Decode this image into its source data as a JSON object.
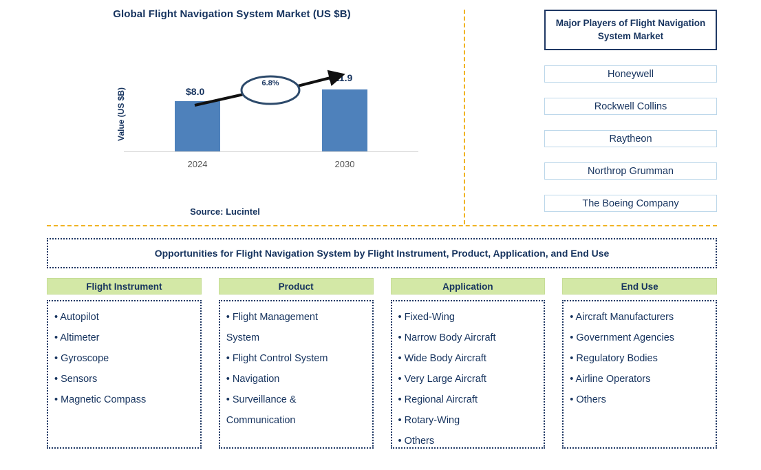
{
  "chart_panel": {
    "title": "Global Flight Navigation System Market (US $B)",
    "y_axis_label": "Value (US $B)",
    "source": "Source: Lucintel"
  },
  "chart_data": {
    "type": "bar",
    "title": "Global Flight Navigation System Market (US $B)",
    "xlabel": "",
    "ylabel": "Value (US $B)",
    "categories": [
      "2024",
      "2030"
    ],
    "values": [
      8.0,
      11.9
    ],
    "value_labels": [
      "$8.0",
      "$11.9"
    ],
    "ylim": [
      0,
      13
    ],
    "grid": false,
    "legend": "none",
    "bar_color": "#4e81bb",
    "annotation": {
      "label": "6.8%",
      "kind": "cagr-arrow",
      "from_category": "2024",
      "to_category": "2030"
    }
  },
  "players": {
    "header": "Major Players of Flight Navigation System Market",
    "items": [
      {
        "name": "Honeywell"
      },
      {
        "name": "Rockwell Collins"
      },
      {
        "name": "Raytheon"
      },
      {
        "name": "Northrop Grumman"
      },
      {
        "name": "The Boeing Company"
      }
    ]
  },
  "opportunities": {
    "banner": "Opportunities for Flight Navigation System by Flight Instrument, Product, Application, and End Use",
    "columns": [
      {
        "header": "Flight Instrument",
        "items": [
          "• Autopilot",
          "• Altimeter",
          "• Gyroscope",
          "• Sensors",
          "• Magnetic Compass"
        ]
      },
      {
        "header": "Product",
        "items": [
          "• Flight Management\nSystem",
          "• Flight Control System",
          "• Navigation",
          "• Surveillance &\nCommunication"
        ]
      },
      {
        "header": "Application",
        "items": [
          "• Fixed-Wing",
          "• Narrow Body Aircraft",
          "• Wide Body Aircraft",
          "• Very Large Aircraft",
          "• Regional Aircraft",
          "• Rotary-Wing",
          "• Others"
        ]
      },
      {
        "header": "End Use",
        "items": [
          "• Aircraft Manufacturers",
          "• Government Agencies",
          "• Regulatory Bodies",
          "• Airline Operators",
          "• Others"
        ]
      }
    ]
  },
  "colors": {
    "navy": "#16335e",
    "bar_blue": "#4e81bb",
    "divider_amber": "#f0b323",
    "segment_green": "#d3e8a6",
    "player_border": "#bcd7ea"
  }
}
